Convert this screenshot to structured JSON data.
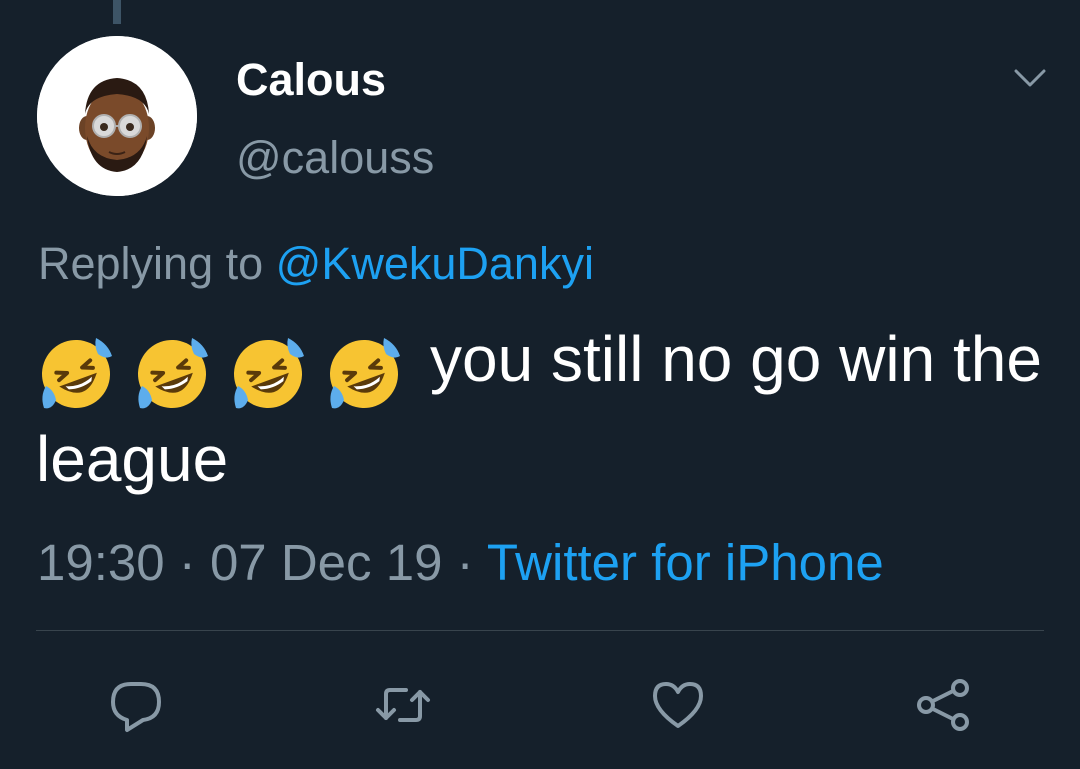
{
  "tweet": {
    "display_name": "Calous",
    "handle": "@calouss",
    "replying_prefix": "Replying to",
    "replying_to": "@KwekuDankyi",
    "text": "you still no go win the league",
    "emoji_count": 4,
    "emoji_icon": "rolling-on-floor-laughing-emoji",
    "timestamp": "19:30 · 07 Dec 19 · ",
    "source": "Twitter for iPhone"
  },
  "actions": [
    {
      "icon": "reply-icon"
    },
    {
      "icon": "retweet-icon"
    },
    {
      "icon": "like-icon"
    },
    {
      "icon": "share-icon"
    }
  ],
  "colors": {
    "background": "#15202b",
    "primary_text": "#ffffff",
    "secondary_text": "#8899a6",
    "accent": "#1da1f2",
    "divider": "#38444d"
  }
}
